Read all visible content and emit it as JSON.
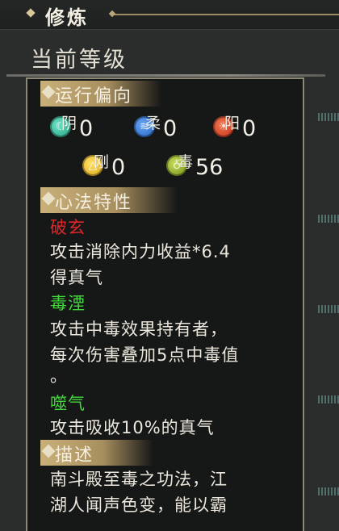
{
  "header": {
    "title": "修炼"
  },
  "level": {
    "label": "当前等级"
  },
  "orientation": {
    "heading": "运行偏向",
    "stats": [
      {
        "name": "阴",
        "value": "0",
        "icon": "yin-orb-icon",
        "color": "#1e9c7d"
      },
      {
        "name": "柔",
        "value": "0",
        "icon": "rou-orb-icon",
        "color": "#1f5cbf"
      },
      {
        "name": "阳",
        "value": "0",
        "icon": "yang-orb-icon",
        "color": "#c22b14"
      },
      {
        "name": "刚",
        "value": "0",
        "icon": "gang-orb-icon",
        "color": "#d9a412"
      },
      {
        "name": "毒",
        "value": "56",
        "icon": "du-orb-icon",
        "color": "#6d8d12"
      }
    ]
  },
  "traits": {
    "heading": "心法特性",
    "items": [
      {
        "name": "破玄",
        "name_color": "#e0262a",
        "lines": [
          "攻击消除内力收益*6.4",
          "得真气"
        ]
      },
      {
        "name": "毒湮",
        "name_color": "#41d83a",
        "lines": [
          "攻击中毒效果持有者，",
          "每次伤害叠加5点中毒值",
          "。"
        ]
      },
      {
        "name": "噬气",
        "name_color": "#41d83a",
        "lines": [
          "攻击吸收10%的真气"
        ]
      }
    ]
  },
  "description": {
    "heading": "描述",
    "lines": [
      "南斗殿至毒之功法，江",
      "湖人闻声色变，能以霸"
    ]
  }
}
